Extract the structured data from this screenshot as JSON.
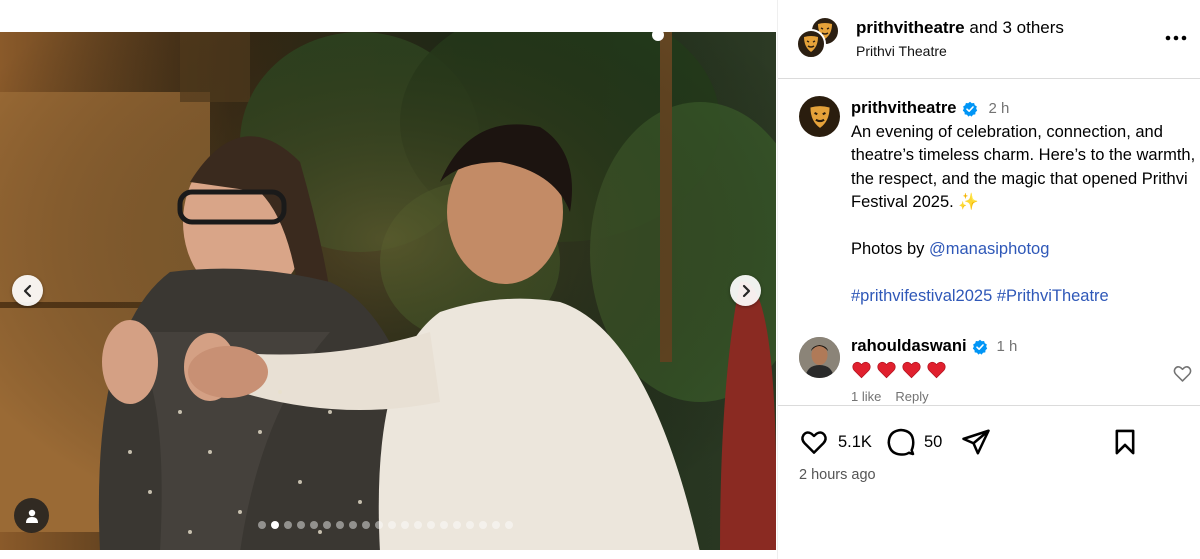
{
  "header": {
    "primary_user": "prithvitheatre",
    "collab_suffix": "and 3 others",
    "location": "Prithvi Theatre",
    "more_options_icon": "more-horizontal-icon"
  },
  "caption": {
    "username": "prithvitheatre",
    "verified": true,
    "time_ago": "2 h",
    "text_line": "An evening of celebration, connection, and theatre’s timeless charm. Here’s to the warmth, the respect, and the magic that opened Prithvi Festival 2025. ",
    "sparkle_emoji": "✨",
    "photos_by": "Photos by ",
    "mention": "@manasiphotog",
    "hashtag_1": "#prithvifestival2025",
    "hashtag_2": "#PrithviTheatre"
  },
  "comments": [
    {
      "username": "rahouldaswani",
      "verified": true,
      "time_ago": "1 h",
      "hearts": 4,
      "likes_label": "1 like",
      "reply_label": "Reply"
    }
  ],
  "actions": {
    "likes_count": "5.1K",
    "comments_count": "50",
    "posted": "2 hours ago"
  },
  "carousel": {
    "total_slides": 20,
    "active_index": 2
  },
  "colors": {
    "link_blue": "#2f58b8",
    "verified_blue": "#0095f6",
    "heart_red": "#e0202e",
    "divider": "#dbdbdb"
  }
}
